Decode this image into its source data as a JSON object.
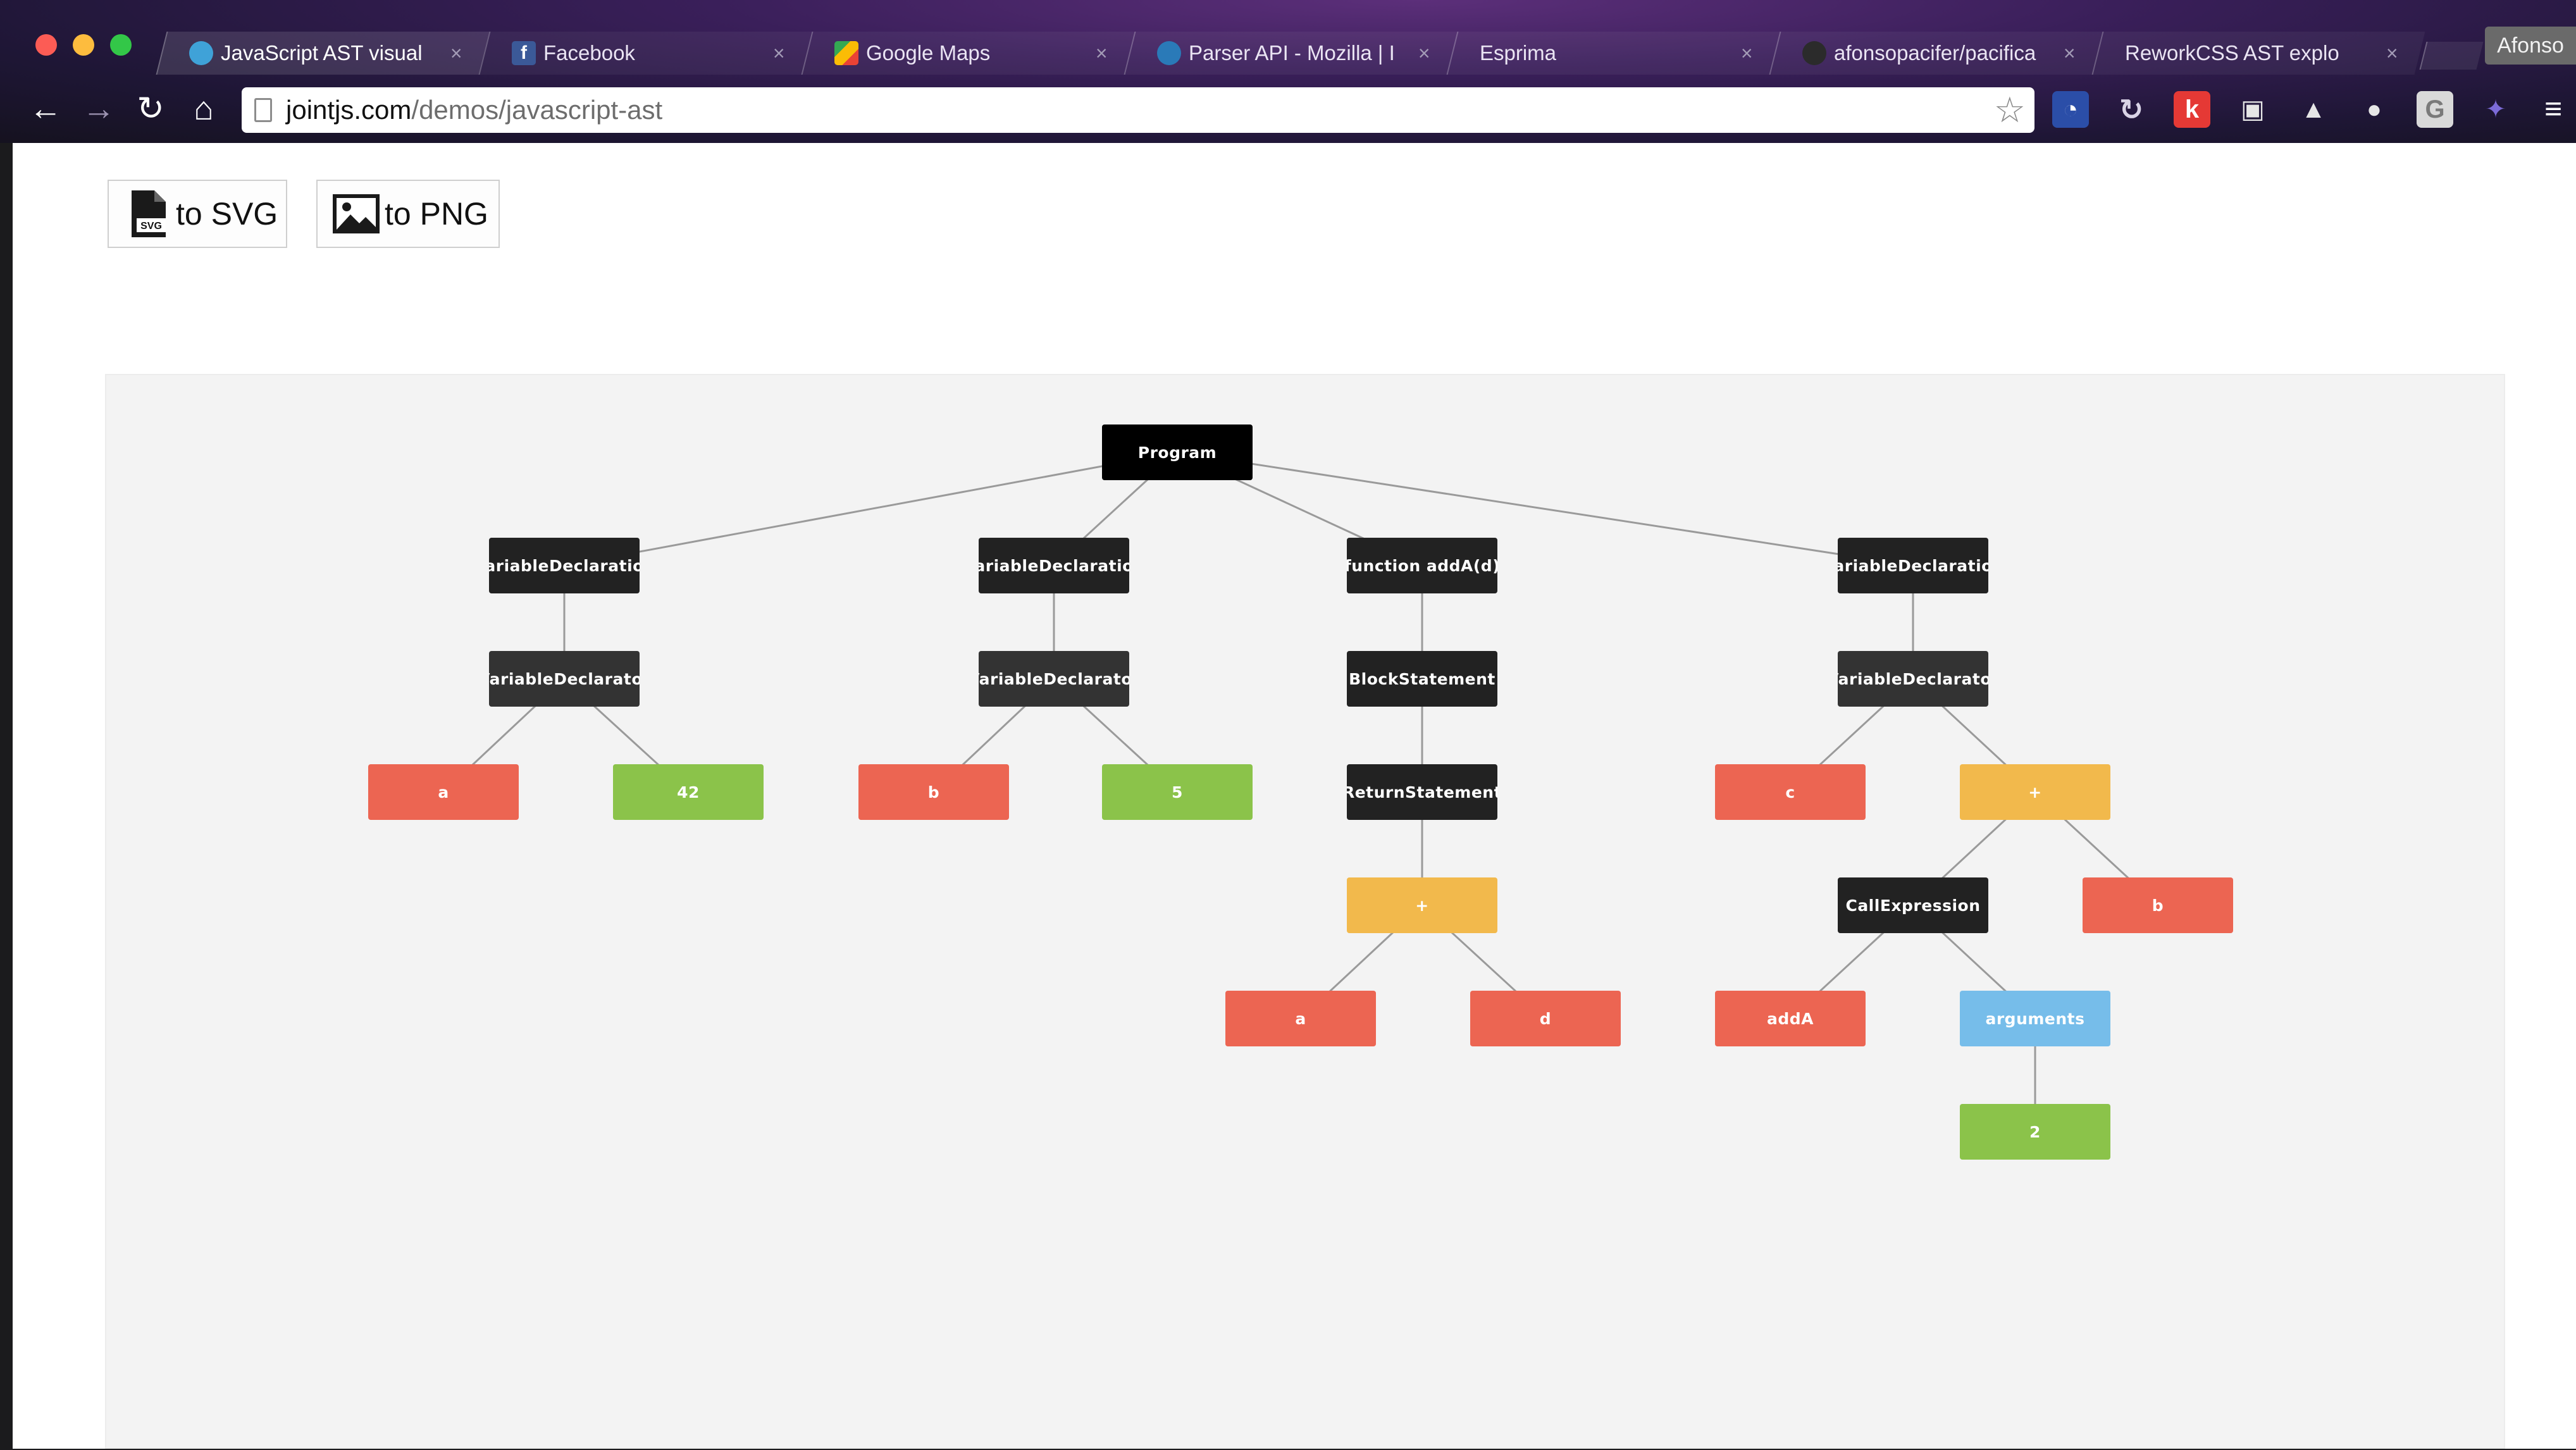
{
  "browser": {
    "tabs": [
      {
        "title": "JavaScript AST visual",
        "favicon": "jointjs-icon",
        "active": true
      },
      {
        "title": "Facebook",
        "favicon": "facebook-icon",
        "active": false
      },
      {
        "title": "Google Maps",
        "favicon": "google-maps-icon",
        "active": false
      },
      {
        "title": "Parser API - Mozilla | I",
        "favicon": "mdn-icon",
        "active": false
      },
      {
        "title": "Esprima",
        "favicon": "page-icon",
        "active": false
      },
      {
        "title": "afonsopacifer/pacifica",
        "favicon": "github-icon",
        "active": false
      },
      {
        "title": "ReworkCSS AST explo",
        "favicon": "",
        "active": false
      }
    ],
    "tab_close_glyph": "×",
    "user_name": "Afonso",
    "url_host": "jointjs.com",
    "url_path": "/demos/javascript-ast",
    "nav": {
      "back": "←",
      "forward": "→",
      "reload": "↻",
      "home": "⌂",
      "star": "☆",
      "menu": "≡"
    },
    "extensions": [
      "speed-dial-icon",
      "sync-icon",
      "k-icon",
      "camera-icon",
      "drive-icon",
      "ghostery-icon",
      "g-icon",
      "bat-icon"
    ],
    "ext_k_label": "k",
    "ext_g_label": "G"
  },
  "toolbar": {
    "svg_label": "to SVG",
    "png_label": "to PNG",
    "svg_icon_tag": "SVG"
  },
  "diagram": {
    "nodes": [
      {
        "id": "program",
        "label": "Program",
        "kind": "program"
      },
      {
        "id": "vd1",
        "label": "VariableDeclaration",
        "kind": "dark"
      },
      {
        "id": "vd2",
        "label": "VariableDeclaration",
        "kind": "dark"
      },
      {
        "id": "fn",
        "label": "function addA(d)",
        "kind": "dark"
      },
      {
        "id": "vd3",
        "label": "VariableDeclaration",
        "kind": "dark"
      },
      {
        "id": "vdr1",
        "label": "VariableDeclarator",
        "kind": "darkgray"
      },
      {
        "id": "vdr2",
        "label": "VariableDeclarator",
        "kind": "darkgray"
      },
      {
        "id": "block",
        "label": "BlockStatement",
        "kind": "dark"
      },
      {
        "id": "vdr3",
        "label": "VariableDeclarator",
        "kind": "darkgray"
      },
      {
        "id": "a1",
        "label": "a",
        "kind": "red"
      },
      {
        "id": "n42",
        "label": "42",
        "kind": "green"
      },
      {
        "id": "b1",
        "label": "b",
        "kind": "red"
      },
      {
        "id": "n5",
        "label": "5",
        "kind": "green"
      },
      {
        "id": "ret",
        "label": "ReturnStatement",
        "kind": "dark"
      },
      {
        "id": "c1",
        "label": "c",
        "kind": "red"
      },
      {
        "id": "plus2",
        "label": "+",
        "kind": "yellow"
      },
      {
        "id": "plus1",
        "label": "+",
        "kind": "yellow"
      },
      {
        "id": "call",
        "label": "CallExpression",
        "kind": "dark"
      },
      {
        "id": "b2",
        "label": "b",
        "kind": "red"
      },
      {
        "id": "a2",
        "label": "a",
        "kind": "red"
      },
      {
        "id": "d1",
        "label": "d",
        "kind": "red"
      },
      {
        "id": "addA",
        "label": "addA",
        "kind": "red"
      },
      {
        "id": "args",
        "label": "arguments",
        "kind": "blue"
      },
      {
        "id": "n2",
        "label": "2",
        "kind": "green"
      }
    ],
    "edges": [
      [
        "program",
        "vd1"
      ],
      [
        "program",
        "vd2"
      ],
      [
        "program",
        "fn"
      ],
      [
        "program",
        "vd3"
      ],
      [
        "vd1",
        "vdr1"
      ],
      [
        "vd2",
        "vdr2"
      ],
      [
        "fn",
        "block"
      ],
      [
        "vd3",
        "vdr3"
      ],
      [
        "vdr1",
        "a1"
      ],
      [
        "vdr1",
        "n42"
      ],
      [
        "vdr2",
        "b1"
      ],
      [
        "vdr2",
        "n5"
      ],
      [
        "block",
        "ret"
      ],
      [
        "vdr3",
        "c1"
      ],
      [
        "vdr3",
        "plus2"
      ],
      [
        "ret",
        "plus1"
      ],
      [
        "plus2",
        "call"
      ],
      [
        "plus2",
        "b2"
      ],
      [
        "plus1",
        "a2"
      ],
      [
        "plus1",
        "d1"
      ],
      [
        "call",
        "addA"
      ],
      [
        "call",
        "args"
      ],
      [
        "args",
        "n2"
      ]
    ]
  }
}
